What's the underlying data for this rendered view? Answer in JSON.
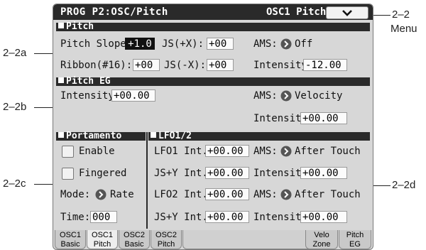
{
  "callouts": {
    "menu_num": "2–2",
    "menu_text": "Menu",
    "a": "2–2a",
    "b": "2–2b",
    "c": "2–2c",
    "d": "2–2d"
  },
  "header": {
    "title": "PROG P2:OSC/Pitch",
    "page": "OSC1 Pitch",
    "menu_icon": "chevron-down-icon"
  },
  "pitch": {
    "section": "Pitch",
    "slope_label": "Pitch Slope:",
    "slope_value": "+1.0",
    "jsx_label": "JS(+X):",
    "jsx_value": "+00",
    "ams_label": "AMS:",
    "ams_value": "Off",
    "ribbon_label": "Ribbon(#16):",
    "ribbon_value": "+00",
    "jsmx_label": "JS(-X):",
    "jsmx_value": "+00",
    "intensity_label": "Intensity:",
    "intensity_value": "-12.00"
  },
  "pitch_eg": {
    "section": "Pitch EG",
    "intensity_label": "Intensity:",
    "intensity_value": "+00.00",
    "ams_label": "AMS:",
    "ams_value": "Velocity",
    "ams_intensity_label": "Intensity:",
    "ams_intensity_value": "+00.00"
  },
  "portamento": {
    "section": "Portamento",
    "enable_label": "Enable",
    "fingered_label": "Fingered",
    "mode_label": "Mode:",
    "mode_value": "Rate",
    "time_label": "Time:",
    "time_value": "000"
  },
  "lfo": {
    "section": "LFO1/2",
    "lfo1_label": "LFO1 Int.:",
    "lfo1_value": "+00.00",
    "ams1_label": "AMS:",
    "ams1_value": "After Touch",
    "jsy1_label": "JS+Y Int.:",
    "jsy1_value": "+00.00",
    "int1_label": "Intensity:",
    "int1_value": "+00.00",
    "lfo2_label": "LFO2 Int.:",
    "lfo2_value": "+00.00",
    "ams2_label": "AMS:",
    "ams2_value": "After Touch",
    "jsy2_label": "JS+Y Int.:",
    "jsy2_value": "+00.00",
    "int2_label": "Intensity:",
    "int2_value": "+00.00"
  },
  "tabs": [
    {
      "l1": "OSC1",
      "l2": "Basic"
    },
    {
      "l1": "OSC1",
      "l2": "Pitch"
    },
    {
      "l1": "OSC2",
      "l2": "Basic"
    },
    {
      "l1": "OSC2",
      "l2": "Pitch"
    },
    {
      "l1": "Velo",
      "l2": "Zone"
    },
    {
      "l1": "Pitch",
      "l2": "EG"
    }
  ],
  "colors": {
    "panel": "#d7d7d7",
    "bar": "#2a2a2a",
    "active_tab": "#eeeeee"
  }
}
